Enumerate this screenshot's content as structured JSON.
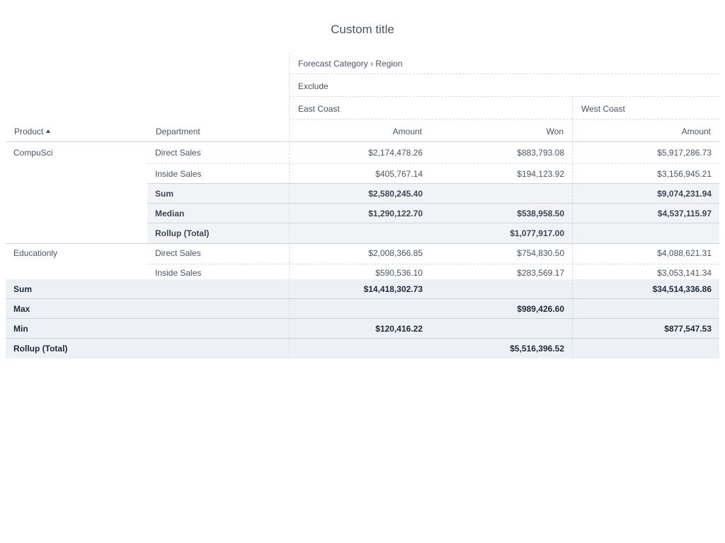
{
  "title": "Custom title",
  "header": {
    "dimension_path": "Forecast Category › Region",
    "category": "Exclude",
    "regions": [
      "East Coast",
      "West Coast"
    ],
    "row_headers": {
      "product": "Product",
      "department": "Department"
    },
    "measures": [
      "Amount",
      "Won",
      "Amount"
    ]
  },
  "body": {
    "groups": [
      {
        "product": "CompuSci",
        "rows": [
          {
            "label": "Direct Sales",
            "type": "data",
            "values": [
              "$2,174,478.26",
              "$883,793.08",
              "$5,917,286.73"
            ]
          },
          {
            "label": "Inside Sales",
            "type": "data",
            "values": [
              "$405,767.14",
              "$194,123.92",
              "$3,156,945.21"
            ]
          },
          {
            "label": "Sum",
            "type": "subtotal",
            "values": [
              "$2,580,245.40",
              "",
              "$9,074,231.94"
            ]
          },
          {
            "label": "Median",
            "type": "subtotal",
            "values": [
              "$1,290,122.70",
              "$538,958.50",
              "$4,537,115.97"
            ]
          },
          {
            "label": "Rollup (Total)",
            "type": "subtotal",
            "values": [
              "",
              "$1,077,917.00",
              ""
            ]
          }
        ]
      },
      {
        "product": "Educationly",
        "rows": [
          {
            "label": "Direct Sales",
            "type": "data",
            "values": [
              "$2,008,366.85",
              "$754,830.50",
              "$4,088,621.31"
            ]
          },
          {
            "label": "Inside Sales",
            "type": "data",
            "values": [
              "$590,536.10",
              "$283,569.17",
              "$3,053,141.34"
            ]
          }
        ]
      }
    ]
  },
  "totals": [
    {
      "label": "Sum",
      "values": [
        "$14,418,302.73",
        "",
        "$34,514,336.86"
      ]
    },
    {
      "label": "Max",
      "values": [
        "",
        "$989,426.60",
        ""
      ]
    },
    {
      "label": "Min",
      "values": [
        "$120,416.22",
        "",
        "$877,547.53"
      ]
    },
    {
      "label": "Rollup (Total)",
      "values": [
        "",
        "$5,516,396.52",
        ""
      ]
    }
  ]
}
